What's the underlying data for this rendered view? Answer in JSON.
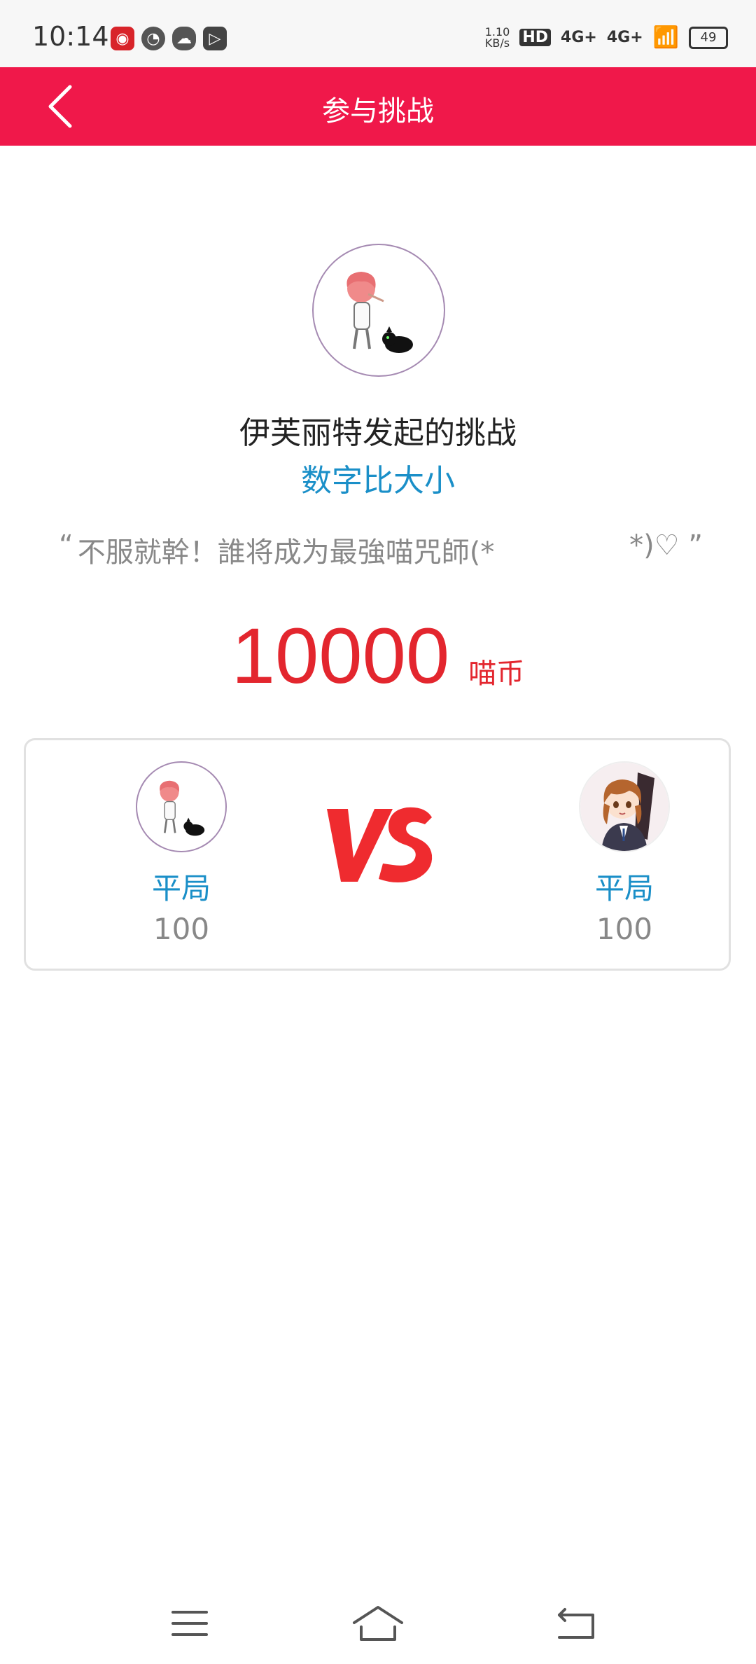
{
  "status_bar": {
    "time": "10:14",
    "net_speed_value": "1.10",
    "net_speed_unit": "KB/s",
    "hd_label": "HD",
    "network1": "4G+",
    "network2": "4G+",
    "battery": "49"
  },
  "app_bar": {
    "title": "参与挑战"
  },
  "challenge": {
    "initiator_text": "伊芙丽特发起的挑战",
    "game_name": "数字比大小",
    "quote_open": "“",
    "quote_text": "不服就幹！誰将成为最強喵咒師(*",
    "quote_tail": "*)♡ ”",
    "prize_amount": "10000",
    "prize_unit": "喵币"
  },
  "versus": {
    "left_player": {
      "status": "平局",
      "score": "100"
    },
    "right_player": {
      "status": "平局",
      "score": "100"
    },
    "vs_label": "VS"
  },
  "colors": {
    "app_bar": "#f0184a",
    "accent_blue": "#1a8fc8",
    "prize_red": "#e3262e"
  },
  "icons": [
    "back-arrow-icon",
    "menu-icon",
    "home-icon",
    "back-nav-icon"
  ]
}
